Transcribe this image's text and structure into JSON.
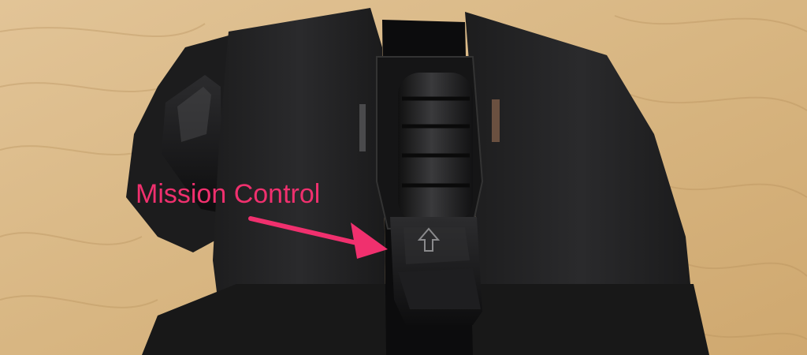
{
  "annotation": {
    "label": "Mission Control",
    "color": "#f0306e"
  },
  "scene": {
    "subject": "mouse-top-view",
    "surface": "wood-table",
    "icons": [
      "arrow-up-icon",
      "scroll-wheel-icon"
    ]
  }
}
